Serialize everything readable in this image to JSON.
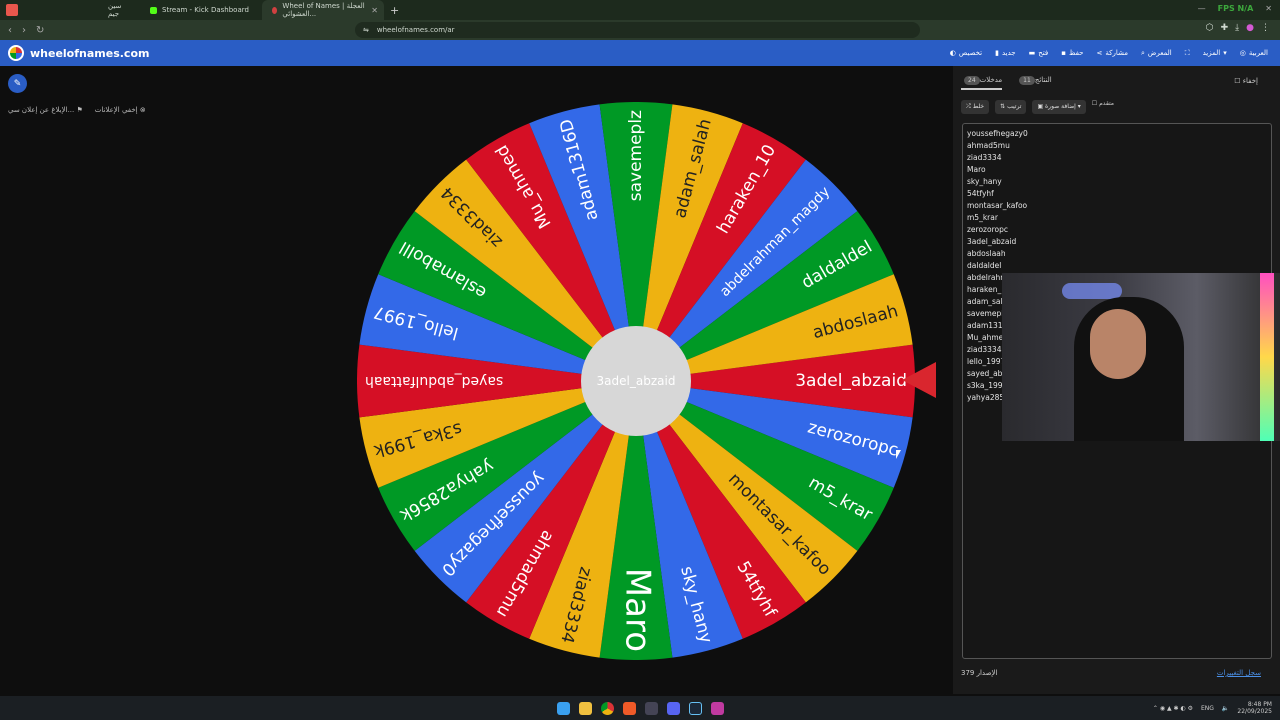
{
  "browser": {
    "tabs": [
      {
        "title": "سين جيم",
        "color": "#e8574d"
      },
      {
        "title": "Stream - Kick Dashboard",
        "color": "#53fc18"
      },
      {
        "title": "Wheel of Names | العجلة العشوائي...",
        "color": "#d04040"
      }
    ],
    "url": "wheelofnames.com/ar",
    "corner_text": "FPS N/A"
  },
  "site": {
    "name": "wheelofnames.com",
    "menu": [
      "تخصيص",
      "جديد",
      "فتح",
      "حفظ",
      "مشاركة",
      "المعرض",
      "ملء الشاشة",
      "المزيد",
      "العربية"
    ]
  },
  "left": {
    "edit_icon": "pencil-icon",
    "hide_ads": "إخفي الإعلانات",
    "report_ad": "الإبلاغ عن إعلان سي..."
  },
  "wheel": {
    "center_text": "3adel_abzaid",
    "colors": {
      "green": "#009925",
      "yellow": "#eeb211",
      "red": "#d50f25",
      "blue": "#3369e8"
    },
    "slices": [
      "3adel_abzaid",
      "zerozoropc",
      "m5_krar",
      "montasar_kafoo",
      "54tfyhf",
      "sky_hany",
      "Maro",
      "ziad3334",
      "ahmad5mu",
      "youssefhegazy0",
      "yahya2856k",
      "s3ka_199k",
      "sayed_abdulfattaah",
      "lello_1997",
      "eslamabolll",
      "ziad3334",
      "Mu_ahmed",
      "adam1316D",
      "savemeplz",
      "adam_salah",
      "haraken_10",
      "abdelrahman_magdy",
      "daldaldel",
      "abdoslaah"
    ]
  },
  "panel": {
    "tab_entries": "مدخلات",
    "entries_count": "24",
    "tab_results": "النتائج",
    "results_count": "11",
    "hide": "إخفاء",
    "tools": [
      "خلط",
      "ترتيب",
      "إضافة صورة",
      "متقدم"
    ],
    "entries": [
      "youssefhegazy0",
      "ahmad5mu",
      "ziad3334",
      "Maro",
      "sky_hany",
      "54tfyhf",
      "montasar_kafoo",
      "m5_krar",
      "zerozoropc",
      "3adel_abzaid",
      "abdoslaah",
      "daldaldel",
      "abdelrahm",
      "haraken_1",
      "adam_sala",
      "savemeplz",
      "adam1316",
      "Mu_ahme",
      "ziad3334",
      "lello_1997",
      "sayed_abd",
      "s3ka_199k",
      "yahya2856"
    ],
    "version_label": "الإصدار 379",
    "changelog": "سجل التغييرات"
  },
  "taskbar": {
    "lang": "ENG",
    "time": "8:48 PM",
    "date": "22/09/2025"
  }
}
